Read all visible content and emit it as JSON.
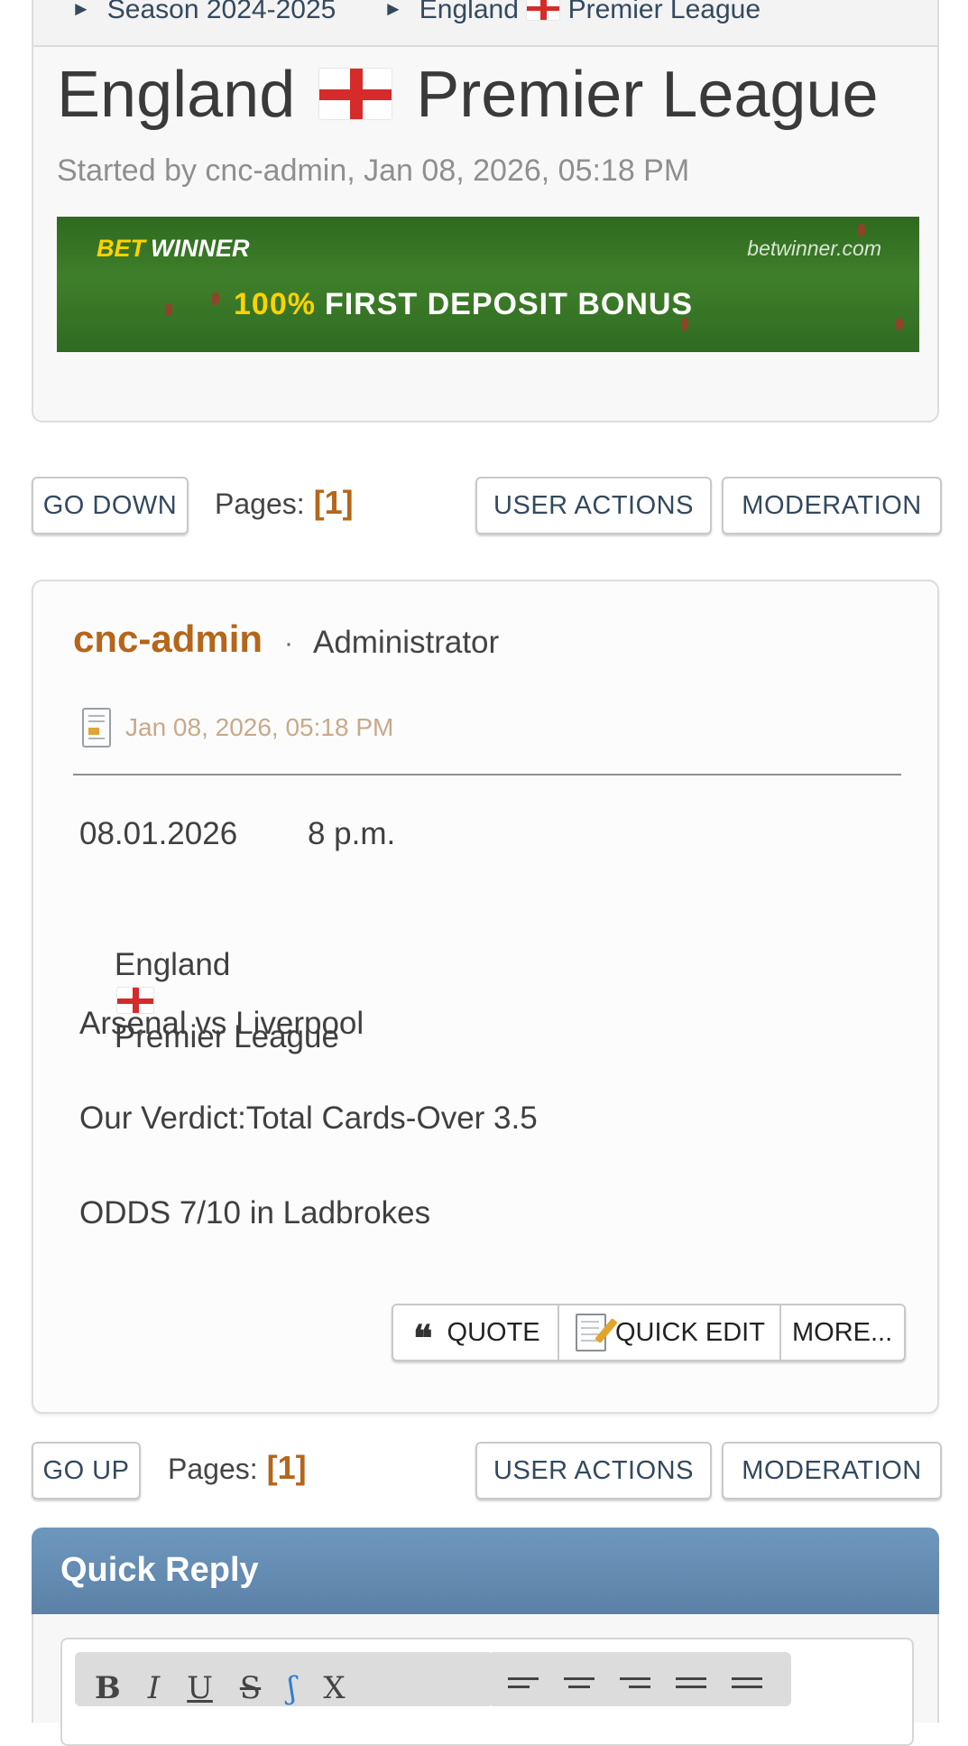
{
  "breadcrumb": {
    "items": [
      {
        "label": "Season 2024-2025"
      },
      {
        "label_before_flag": "England",
        "label_after_flag": "Premier League"
      }
    ]
  },
  "topic": {
    "title_before_flag": "England",
    "title_after_flag": "Premier League",
    "started_by": "Started by cnc-admin, Jan 08, 2026, 05:18 PM"
  },
  "banner": {
    "logo_bet": "BET",
    "logo_winner": "WINNER",
    "site": "betwinner.com",
    "slogan_pct": "100%",
    "slogan_text": "FIRST DEPOSIT BONUS"
  },
  "top_bar": {
    "go_down": "GO DOWN",
    "pages_label": "Pages:",
    "pages_value": "[1]",
    "user_actions": "USER ACTIONS",
    "moderation": "MODERATION"
  },
  "post": {
    "author": "cnc-admin",
    "separator": "·",
    "role": "Administrator",
    "date": "Jan 08, 2026, 05:18 PM",
    "lines": {
      "date_time": "08.01.2026        8 p.m.",
      "league_before_flag": "England",
      "league_after_flag": "Premier League",
      "match": "Arsenal vs Liverpool",
      "verdict": "Our Verdict:Total Cards-Over 3.5",
      "odds": "ODDS 7/10 in Ladbrokes"
    },
    "actions": {
      "quote": "QUOTE",
      "quick_edit": "QUICK EDIT",
      "more": "MORE..."
    }
  },
  "bottom_bar": {
    "go_up": "GO UP",
    "pages_label": "Pages:",
    "pages_value": "[1]",
    "user_actions": "USER ACTIONS",
    "moderation": "MODERATION"
  },
  "quick_reply": {
    "title": "Quick Reply",
    "toolbar_format": [
      "B",
      "I",
      "U",
      "S",
      "ʃ",
      "X"
    ]
  },
  "colors": {
    "username": "#b4661a",
    "page_number": "#b4661a",
    "quick_reply_header": "#5f86ad",
    "banner_accent": "#ffd200"
  }
}
